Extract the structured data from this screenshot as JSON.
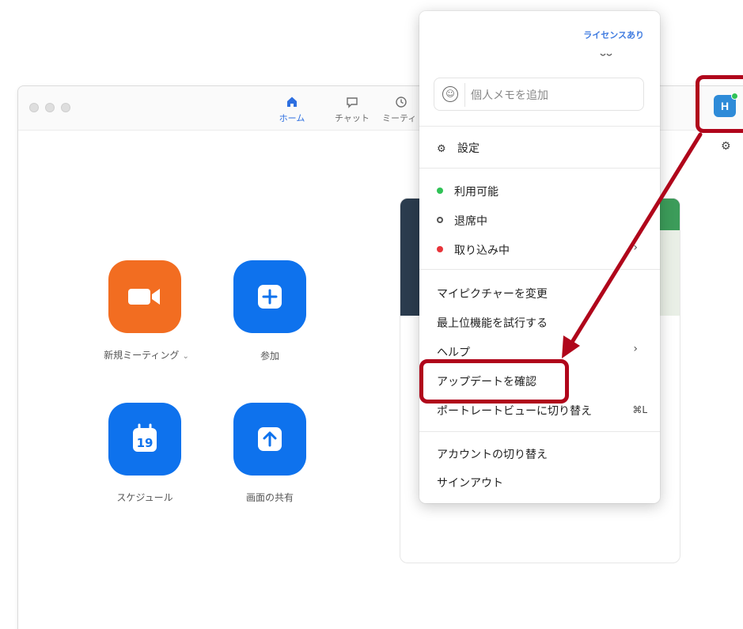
{
  "tabs": [
    {
      "label": "ホーム",
      "icon": "home-icon"
    },
    {
      "label": "チャット",
      "icon": "chat-icon"
    },
    {
      "label": "ミーティ",
      "icon": "clock-icon"
    }
  ],
  "home_buttons": [
    {
      "label": "新規ミーティング",
      "icon": "video-camera-icon",
      "color": "#f26d21"
    },
    {
      "label": "参加",
      "icon": "plus-icon",
      "color": "#0e72ed"
    },
    {
      "label": "スケジュール",
      "icon": "calendar-icon",
      "color": "#0e72ed",
      "calendar_day": "19"
    },
    {
      "label": "画面の共有",
      "icon": "share-up-arrow-icon",
      "color": "#0e72ed"
    }
  ],
  "avatar": {
    "initial": "H",
    "status_color": "#30c256"
  },
  "menu": {
    "license": "ライセンスあり",
    "memo_placeholder": "個人メモを追加",
    "settings": "設定",
    "status": [
      {
        "label": "利用可能",
        "color": "#30c256"
      },
      {
        "label": "退席中",
        "color": "#555555"
      },
      {
        "label": "取り込み中",
        "color": "#e8343a"
      }
    ],
    "change_picture": "マイピクチャーを変更",
    "try_top_features": "最上位機能を試行する",
    "help": "ヘルプ",
    "check_updates": "アップデートを確認",
    "portrait_view": "ポートレートビューに切り替え",
    "portrait_shortcut": "⌘L",
    "switch_account": "アカウントの切り替え",
    "sign_out": "サインアウト"
  },
  "annotation_color": "#b0061b"
}
